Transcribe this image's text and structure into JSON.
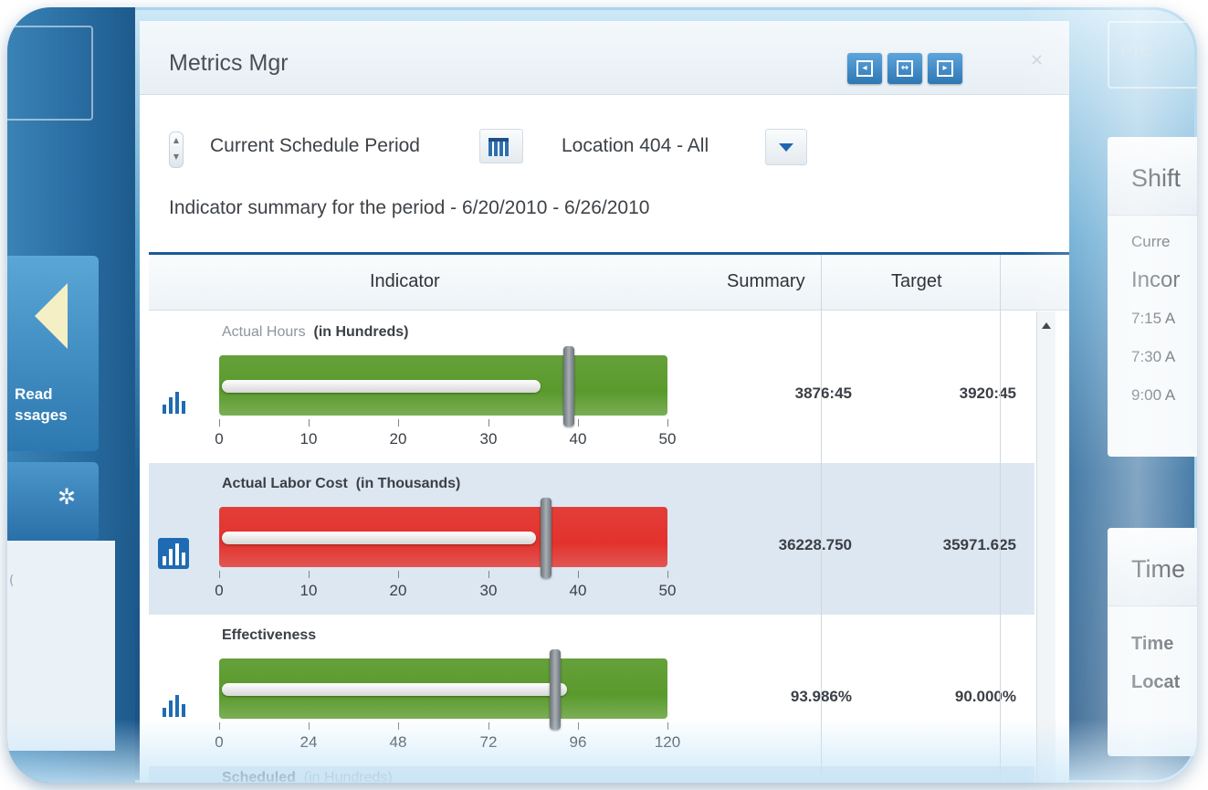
{
  "left_nav": {
    "messages_label_line1": "Read",
    "messages_label_line2": "ssages"
  },
  "panel": {
    "title": "Metrics Mgr",
    "filters": {
      "period": "Current Schedule Period",
      "location": "Location 404 - All"
    },
    "summary_text": "Indicator summary for the period - 6/20/2010 - 6/26/2010",
    "columns": {
      "indicator": "Indicator",
      "summary": "Summary",
      "target": "Target"
    },
    "rows": [
      {
        "label": "Actual Hours",
        "unit": "(in Hundreds)",
        "status_color": "#5a9a2c",
        "actual_fraction": 0.72,
        "target_fraction": 0.78,
        "ticks": [
          "0",
          "10",
          "20",
          "30",
          "40",
          "50"
        ],
        "summary": "3876:45",
        "target": "3920:45"
      },
      {
        "label": "Actual Labor Cost",
        "unit": "(in Thousands)",
        "status_color": "#e3322c",
        "actual_fraction": 0.71,
        "target_fraction": 0.73,
        "ticks": [
          "0",
          "10",
          "20",
          "30",
          "40",
          "50"
        ],
        "summary": "36228.750",
        "target": "35971.625"
      },
      {
        "label": "Effectiveness",
        "unit": "",
        "status_color": "#5a9a2c",
        "actual_fraction": 0.78,
        "target_fraction": 0.75,
        "ticks": [
          "0",
          "24",
          "48",
          "72",
          "96",
          "120"
        ],
        "summary": "93.986%",
        "target": "90.000%"
      },
      {
        "label": "Scheduled",
        "unit": "(in Hundreds)"
      }
    ]
  },
  "right_panels": {
    "top_tab": "Me",
    "shift": {
      "title": "Shift",
      "line1": "Curre",
      "line2": "Incor",
      "times": [
        "7:15 A",
        "7:30 A",
        "9:00 A"
      ]
    },
    "time": {
      "title": "Time",
      "line1": "Time",
      "line2": "Locat"
    }
  },
  "colors": {
    "accent": "#1f6bb3",
    "green": "#5a9a2c",
    "red": "#e3322c"
  }
}
